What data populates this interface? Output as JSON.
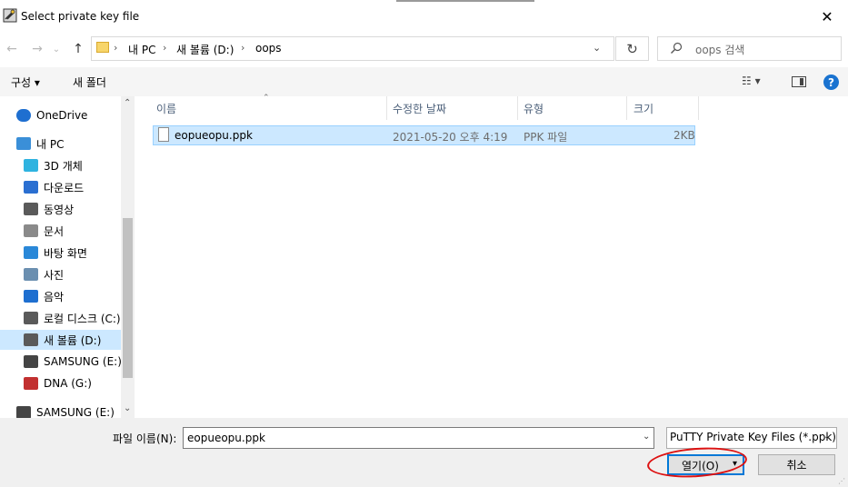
{
  "window": {
    "title": "Select private key file",
    "close_glyph": "✕"
  },
  "nav": {
    "back_glyph": "←",
    "forward_glyph": "→",
    "recent_glyph": "⌄",
    "up_glyph": "↑",
    "breadcrumbs": [
      "내 PC",
      "새 볼륨 (D:)",
      "oops"
    ],
    "sep_glyph": "›",
    "dropdown_glyph": "⌄",
    "refresh_glyph": "↻",
    "search_placeholder": "oops 검색"
  },
  "commandbar": {
    "organize": "구성 ▾",
    "new_folder": "새 폴더",
    "view_glyph": "☷ ▾",
    "help_glyph": "?"
  },
  "sidebar": {
    "items": [
      {
        "label": "OneDrive",
        "icon": "cloud-icon",
        "color": "#1e6fd0"
      },
      {
        "label": "내 PC",
        "icon": "computer-icon",
        "color": "#3a8fd8"
      },
      {
        "label": "3D 개체",
        "icon": "cube-icon",
        "color": "#2fb3e0"
      },
      {
        "label": "다운로드",
        "icon": "download-arrow-icon",
        "color": "#2a6fd1"
      },
      {
        "label": "동영상",
        "icon": "film-icon",
        "color": "#5a5a5a"
      },
      {
        "label": "문서",
        "icon": "document-icon",
        "color": "#8a8a8a"
      },
      {
        "label": "바탕 화면",
        "icon": "desktop-icon",
        "color": "#2a88d8"
      },
      {
        "label": "사진",
        "icon": "picture-icon",
        "color": "#6b8fb0"
      },
      {
        "label": "음악",
        "icon": "music-note-icon",
        "color": "#1e6fd0"
      },
      {
        "label": "로컬 디스크 (C:)",
        "icon": "system-drive-icon",
        "color": "#5a5a5a"
      },
      {
        "label": "새 볼륨 (D:)",
        "icon": "drive-icon",
        "color": "#5a5a5a"
      },
      {
        "label": "SAMSUNG (E:)",
        "icon": "usb-drive-icon",
        "color": "#444444"
      },
      {
        "label": "DNA (G:)",
        "icon": "removable-drive-icon",
        "color": "#c23030"
      },
      {
        "label": "SAMSUNG (E:)",
        "icon": "usb-drive-icon",
        "color": "#444444"
      }
    ],
    "selected_index": 10,
    "scroll_up_glyph": "⌃",
    "scroll_down_glyph": "⌄"
  },
  "filelist": {
    "columns": [
      "이름",
      "수정한 날짜",
      "유형",
      "크기"
    ],
    "sort_glyph": "⌃",
    "rows": [
      {
        "name": "eopueopu.ppk",
        "modified": "2021-05-20 오후 4:19",
        "type": "PPK 파일",
        "size": "2KB"
      }
    ]
  },
  "footer": {
    "filename_label": "파일 이름(N):",
    "filename_value": "eopueopu.ppk",
    "filter_value": "PuTTY Private Key Files (*.ppk)",
    "open_label": "열기(O)",
    "open_split_glyph": "▾",
    "cancel_label": "취소",
    "combo_arrow": "⌄"
  },
  "colors": {
    "accent": "#0078d7",
    "selection": "#cce8ff",
    "annotation": "#dd1111"
  }
}
